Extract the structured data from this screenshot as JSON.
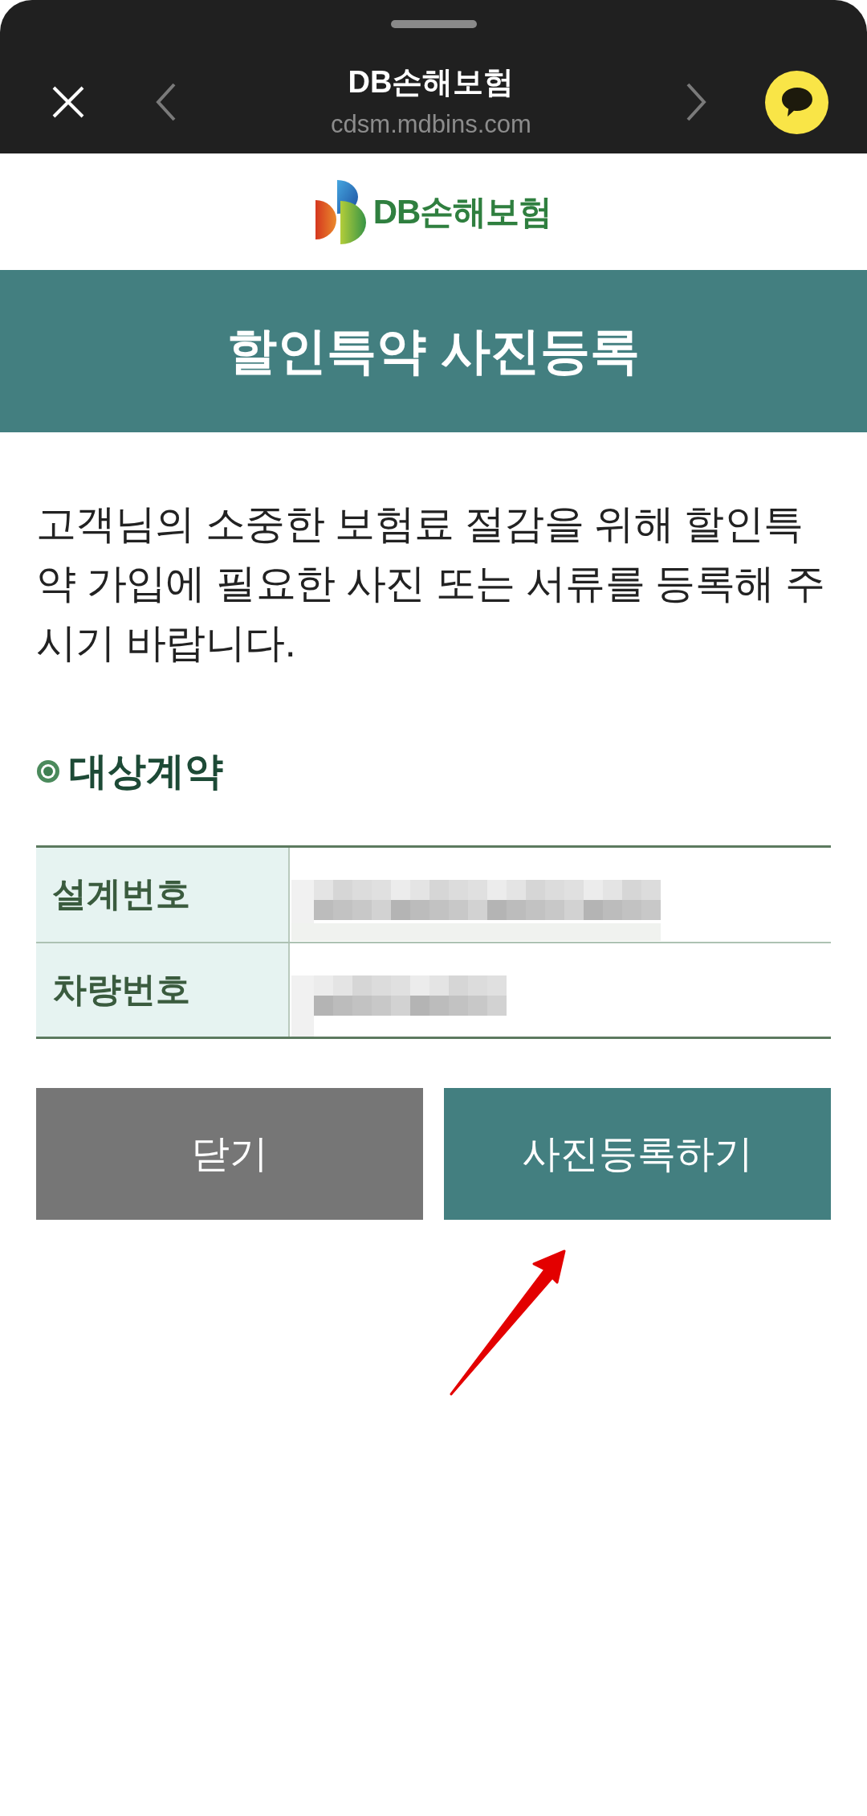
{
  "browser_bar": {
    "title": "DB손해보험",
    "url": "cdsm.mdbins.com",
    "back_button": {
      "disabled": true
    },
    "forward_button": {
      "disabled": true
    }
  },
  "logo": {
    "text": "DB손해보험"
  },
  "banner": {
    "title": "할인특약 사진등록"
  },
  "intro": "고객님의 소중한 보험료 절감을 위해 할인특약 가입에 필요한 사진 또는 서류를 등록해 주시기 바랍니다.",
  "section": {
    "title": "대상계약"
  },
  "table": {
    "rows": [
      {
        "label": "설계번호",
        "redacted": true
      },
      {
        "label": "차량번호",
        "redacted": true
      }
    ]
  },
  "buttons": [
    {
      "label": "닫기",
      "kind": "secondary"
    },
    {
      "label": "사진등록하기",
      "kind": "primary"
    }
  ]
}
